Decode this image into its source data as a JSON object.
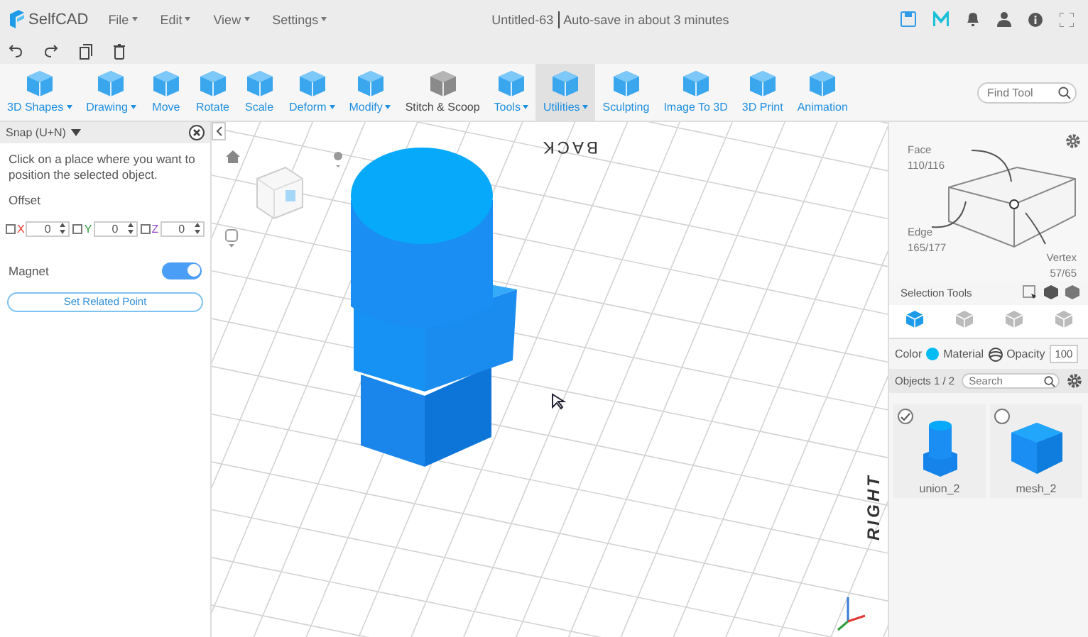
{
  "app": {
    "logo": "SelfCAD",
    "title": "Untitled-63",
    "autosave": "Auto-save in about 3 minutes",
    "menus": [
      {
        "label": "File"
      },
      {
        "label": "Edit"
      },
      {
        "label": "View"
      },
      {
        "label": "Settings"
      }
    ]
  },
  "toolbar": {
    "find_placeholder": "Find Tool",
    "tools": [
      {
        "label": "3D Shapes",
        "dropdown": true,
        "selected": false
      },
      {
        "label": "Drawing",
        "dropdown": true,
        "selected": false
      },
      {
        "label": "Move",
        "dropdown": false,
        "selected": false
      },
      {
        "label": "Rotate",
        "dropdown": false,
        "selected": false
      },
      {
        "label": "Scale",
        "dropdown": false,
        "selected": false
      },
      {
        "label": "Deform",
        "dropdown": true,
        "selected": false
      },
      {
        "label": "Modify",
        "dropdown": true,
        "selected": false
      },
      {
        "label": "Stitch & Scoop",
        "dropdown": false,
        "selected": false
      },
      {
        "label": "Tools",
        "dropdown": true,
        "selected": false
      },
      {
        "label": "Utilities",
        "dropdown": true,
        "selected": true
      },
      {
        "label": "Sculpting",
        "dropdown": false,
        "selected": false
      },
      {
        "label": "Image To 3D",
        "dropdown": false,
        "selected": false
      },
      {
        "label": "3D Print",
        "dropdown": false,
        "selected": false
      },
      {
        "label": "Animation",
        "dropdown": false,
        "selected": false
      }
    ]
  },
  "snap_panel": {
    "title": "Snap (U+N)",
    "instruction": "Click on a place where you want to position the selected object.",
    "offset_label": "Offset",
    "axes": [
      {
        "label": "X",
        "color": "#e53935",
        "checked": false,
        "value": "0"
      },
      {
        "label": "Y",
        "color": "#2e9e3a",
        "checked": false,
        "value": "0"
      },
      {
        "label": "Z",
        "color": "#8e44c9",
        "checked": false,
        "value": "0"
      }
    ],
    "magnet": {
      "label": "Magnet",
      "on": true
    },
    "button": "Set Related Point"
  },
  "viewport": {
    "labels": [
      {
        "text": "BACK",
        "kind": "back"
      },
      {
        "text": "RIGHT",
        "kind": "right"
      }
    ]
  },
  "selection": {
    "face_label": "Face",
    "face_count": "110/116",
    "edge_label": "Edge",
    "edge_count": "165/177",
    "vertex_label": "Vertex",
    "vertex_count": "57/65",
    "tools_label": "Selection Tools",
    "modes": [
      {
        "selected": true
      },
      {
        "selected": false
      },
      {
        "selected": false
      },
      {
        "selected": false
      }
    ]
  },
  "properties": {
    "color_label": "Color",
    "color": "#00bcf2",
    "material_label": "Material",
    "opacity_label": "Opacity",
    "opacity": "100"
  },
  "objects": {
    "title": "Objects 1 / 2",
    "search_placeholder": "Search",
    "items": [
      {
        "name": "union_2",
        "kind": "union",
        "selected": true
      },
      {
        "name": "mesh_2",
        "kind": "cube",
        "selected": false
      }
    ]
  }
}
